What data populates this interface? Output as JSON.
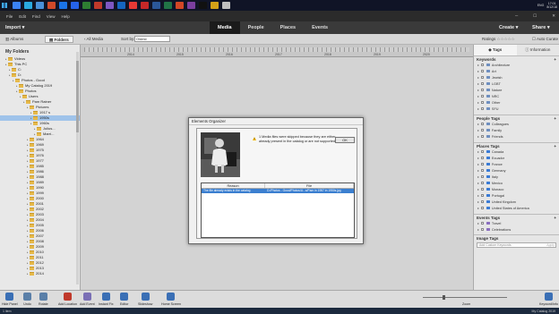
{
  "taskbar": {
    "time": "17:01",
    "date": "8/12/18",
    "lang": "ENG",
    "apps": [
      "#3b82f6",
      "#2aa9e0",
      "#4a90d9",
      "#d04a2a",
      "#1a73e8",
      "#2563eb",
      "#2e7d32",
      "#c0392b",
      "#7e57c2",
      "#1565c0",
      "#e53935",
      "#c62828",
      "#2b579a",
      "#217346",
      "#d24726",
      "#7b3fa0",
      "#111111",
      "#d4a017",
      "#c0c0c0"
    ]
  },
  "menubar": {
    "items": [
      "File",
      "Edit",
      "Find",
      "View",
      "Help"
    ]
  },
  "topbar": {
    "import": "Import",
    "tabs": [
      "Media",
      "People",
      "Places",
      "Events"
    ],
    "create": "Create",
    "share": "Share"
  },
  "subbar": {
    "albums": "Albums",
    "folders": "Folders",
    "all_media": "All Media",
    "sort_by": "Sort by:",
    "sort_value": "Oldest",
    "ratings": "Ratings",
    "auto_curate": "Auto Curate"
  },
  "left": {
    "header": "My Folders",
    "tree": [
      {
        "label": "Videos",
        "indent": 1
      },
      {
        "label": "This PC",
        "indent": 1
      },
      {
        "label": "C:",
        "indent": 2
      },
      {
        "label": "D:",
        "indent": 2
      },
      {
        "label": "Photos - Good",
        "indent": 3
      },
      {
        "label": "My Catalog 2019",
        "indent": 4
      },
      {
        "label": "Photos",
        "indent": 4
      },
      {
        "label": "Users",
        "indent": 5
      },
      {
        "label": "Pam Ratner",
        "indent": 6
      },
      {
        "label": "Pictures",
        "indent": 7
      },
      {
        "label": "1917 s",
        "indent": 8
      },
      {
        "label": "1950s",
        "indent": 8,
        "selected": true
      },
      {
        "label": "1960s",
        "indent": 8
      },
      {
        "label": "Julius...",
        "indent": 9
      },
      {
        "label": "Marri...",
        "indent": 9
      },
      {
        "label": "1964",
        "indent": 7
      },
      {
        "label": "1969",
        "indent": 7
      },
      {
        "label": "1975",
        "indent": 7
      },
      {
        "label": "1976",
        "indent": 7
      },
      {
        "label": "1977",
        "indent": 7
      },
      {
        "label": "1985",
        "indent": 7
      },
      {
        "label": "1986",
        "indent": 7
      },
      {
        "label": "1988",
        "indent": 7
      },
      {
        "label": "1989",
        "indent": 7
      },
      {
        "label": "1990",
        "indent": 7
      },
      {
        "label": "1999",
        "indent": 7
      },
      {
        "label": "2000",
        "indent": 7
      },
      {
        "label": "2001",
        "indent": 7
      },
      {
        "label": "2002",
        "indent": 7
      },
      {
        "label": "2003",
        "indent": 7
      },
      {
        "label": "2004",
        "indent": 7
      },
      {
        "label": "2005",
        "indent": 7
      },
      {
        "label": "2006",
        "indent": 7
      },
      {
        "label": "2007",
        "indent": 7
      },
      {
        "label": "2008",
        "indent": 7
      },
      {
        "label": "2009",
        "indent": 7
      },
      {
        "label": "2010",
        "indent": 7
      },
      {
        "label": "2011",
        "indent": 7
      },
      {
        "label": "2012",
        "indent": 7
      },
      {
        "label": "2013",
        "indent": 7
      },
      {
        "label": "2014",
        "indent": 7
      }
    ]
  },
  "timeline": {
    "years": [
      "2014",
      "2015",
      "2016",
      "2017",
      "2018",
      "2019",
      "2020"
    ]
  },
  "right": {
    "tabs": [
      "Tags",
      "Information"
    ],
    "keywords_header": "Keywords",
    "keywords": [
      {
        "label": "Architecture",
        "color": "#6f8fbf"
      },
      {
        "label": "Art",
        "color": "#6f8fbf"
      },
      {
        "label": "Jewish",
        "color": "#6f8fbf"
      },
      {
        "label": "LGBT",
        "color": "#6f8fbf"
      },
      {
        "label": "Nature",
        "color": "#6f8fbf"
      },
      {
        "label": "NRC",
        "color": "#6f8fbf"
      },
      {
        "label": "Other",
        "color": "#6f8fbf"
      },
      {
        "label": "SFU",
        "color": "#6f8fbf"
      }
    ],
    "people_header": "People Tags",
    "people": [
      {
        "label": "Colleagues",
        "color": "#6f8fbf"
      },
      {
        "label": "Family",
        "color": "#6f8fbf"
      },
      {
        "label": "Friends",
        "color": "#6f8fbf"
      }
    ],
    "places_header": "Places Tags",
    "places": [
      {
        "label": "Canada",
        "color": "#3a7bd5"
      },
      {
        "label": "Ecuador",
        "color": "#3a7bd5"
      },
      {
        "label": "France",
        "color": "#3a7bd5"
      },
      {
        "label": "Germany",
        "color": "#3a7bd5"
      },
      {
        "label": "Italy",
        "color": "#3a7bd5"
      },
      {
        "label": "Mexico",
        "color": "#3a7bd5"
      },
      {
        "label": "Monaco",
        "color": "#3a7bd5"
      },
      {
        "label": "Portugal",
        "color": "#3a7bd5"
      },
      {
        "label": "United Kingdom",
        "color": "#3a7bd5"
      },
      {
        "label": "United States of America",
        "color": "#3a7bd5"
      }
    ],
    "events_header": "Events Tags",
    "events": [
      {
        "label": "Travel",
        "color": "#8a6fbf"
      },
      {
        "label": "Celebrations",
        "color": "#8a6fbf"
      }
    ],
    "image_tags_header": "Image Tags",
    "add_keyword_placeholder": "Add Custom Keywords",
    "apply": "Apply"
  },
  "bottombar": {
    "tools": [
      {
        "label": "Hide Panel",
        "color": "#3a6fb5"
      },
      {
        "label": "Undo",
        "color": "#5a7fa8"
      },
      {
        "label": "Rotate",
        "color": "#5a7fa8"
      },
      {
        "label": "Add Location",
        "color": "#c0392b"
      },
      {
        "label": "Add Event",
        "color": "#7a6fb5"
      },
      {
        "label": "Instant Fix",
        "color": "#3a6fb5"
      },
      {
        "label": "Editor",
        "color": "#3a6fb5"
      },
      {
        "label": "Slideshow",
        "color": "#3a6fb5"
      },
      {
        "label": "Home Screen",
        "color": "#3a6fb5"
      },
      {
        "label": "Keyword/Info",
        "color": "#3a6fb5"
      }
    ],
    "zoom": "Zoom"
  },
  "status": {
    "left": "1 item",
    "right": "My Catalog 2019"
  },
  "dialog": {
    "title": "Elements Organizer",
    "message": "1 Media files were skipped because they are either already present in the catalog or are not supported.",
    "ok": "OK",
    "col_reason": "Reason",
    "col_file": "File",
    "row_reason": "The file already exists in the catalog",
    "row_file": "D:/Photos - Good/Photos/U...s/Pam in 1957 in 1950s.jpg"
  }
}
